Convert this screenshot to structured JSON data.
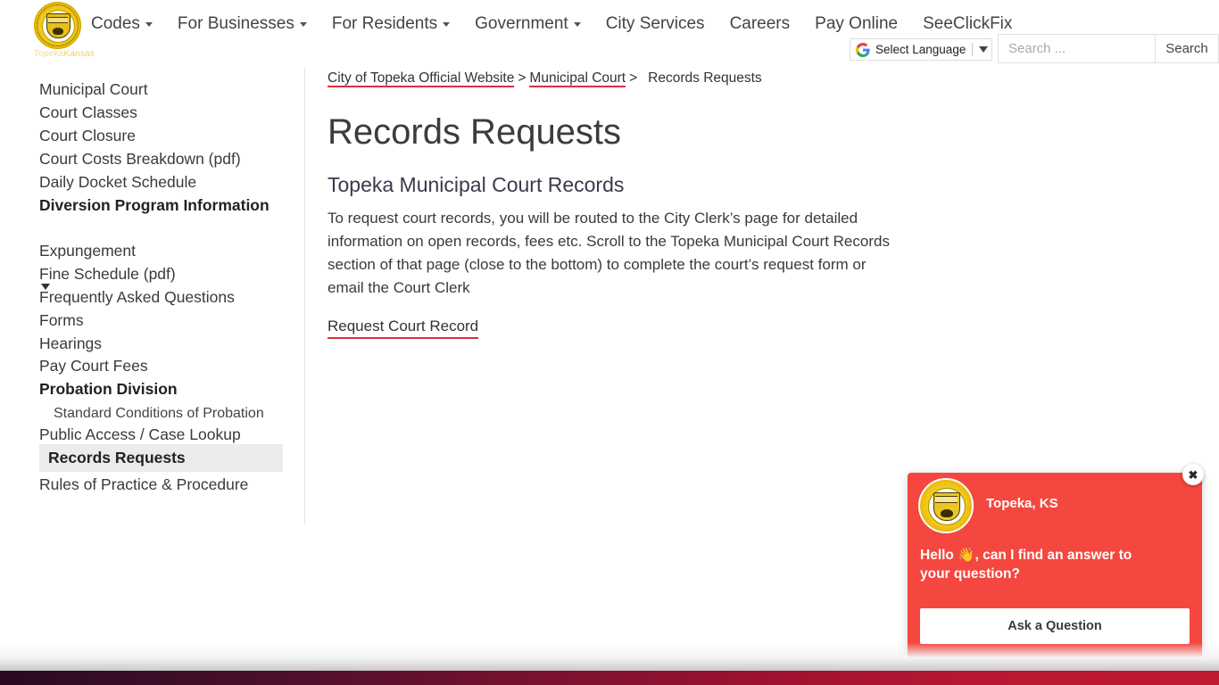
{
  "header": {
    "logo": {
      "seal_alt": "City of Topeka seal",
      "sub_text_1": "Topeka",
      "sub_text_2": "Kansas"
    },
    "nav": [
      {
        "label": "Codes",
        "has_dropdown": true
      },
      {
        "label": "For Businesses",
        "has_dropdown": true
      },
      {
        "label": "For Residents",
        "has_dropdown": true
      },
      {
        "label": "Government",
        "has_dropdown": true
      },
      {
        "label": "City Services",
        "has_dropdown": false
      },
      {
        "label": "Careers",
        "has_dropdown": false
      },
      {
        "label": "Pay Online",
        "has_dropdown": false
      },
      {
        "label": "SeeClickFix",
        "has_dropdown": false
      }
    ],
    "language": {
      "label": "Select Language",
      "icon": "google-g-icon"
    },
    "search": {
      "value": "",
      "placeholder": "Search ...",
      "button_label": "Search"
    }
  },
  "sidebar": {
    "items": [
      {
        "label": "Municipal Court",
        "style": "normal"
      },
      {
        "label": "Court Classes",
        "style": "normal"
      },
      {
        "label": "Court Closure",
        "style": "normal"
      },
      {
        "label": "Court Costs Breakdown (pdf)",
        "style": "normal"
      },
      {
        "label": "Daily Docket Schedule",
        "style": "normal"
      },
      {
        "label": "Diversion Program Information",
        "style": "bold"
      },
      {
        "label": "Expungement",
        "style": "normal"
      },
      {
        "label": "Fine Schedule (pdf)",
        "style": "normal"
      },
      {
        "label": "Frequently Asked Questions",
        "style": "normal"
      },
      {
        "label": "Forms",
        "style": "normal"
      },
      {
        "label": "Hearings",
        "style": "normal"
      },
      {
        "label": "Pay Court Fees",
        "style": "normal"
      },
      {
        "label": "Probation Division",
        "style": "bold"
      },
      {
        "label": "Standard Conditions of Probation",
        "style": "indent"
      },
      {
        "label": "Public Access / Case Lookup",
        "style": "normal"
      },
      {
        "label": "Records Requests",
        "style": "active"
      },
      {
        "label": "Rules of Practice & Procedure",
        "style": "normal"
      }
    ]
  },
  "main": {
    "breadcrumb": {
      "home": "City of Topeka Official Website",
      "sep1": ">",
      "parent": "Municipal Court",
      "sep2": ">",
      "current": "Records Requests"
    },
    "page_title": "Records Requests",
    "section_title": "Topeka Municipal Court Records",
    "paragraph": "To request court records, you will be routed to the City Clerk’s page for detailed information on open records, fees etc.  Scroll to the Topeka Municipal Court Records section of that page (close to the bottom) to complete the court’s request form or email the Court Clerk",
    "link_label": "Request Court Record"
  },
  "chat_widget": {
    "title": "Topeka, KS",
    "message": "Hello 👋, can I find an answer to your question?",
    "button_label": "Ask a Question",
    "close_label": "✖",
    "accent_color": "#f4473f"
  },
  "colors": {
    "link_underline": "#d9303e",
    "active_item_bg": "#ececec",
    "chat_red": "#f4473f",
    "footer_gradient_start": "#2a0a22",
    "footer_gradient_end": "#c01a33"
  }
}
